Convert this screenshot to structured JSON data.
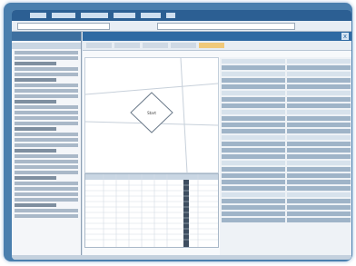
{
  "window": {
    "close_label": "x"
  },
  "diagram": {
    "node_label": "Start"
  },
  "accent_colors": {
    "titlebar": "#2f6aa3",
    "active_tab": "#f0c97a",
    "frame": "#4a7fae"
  }
}
